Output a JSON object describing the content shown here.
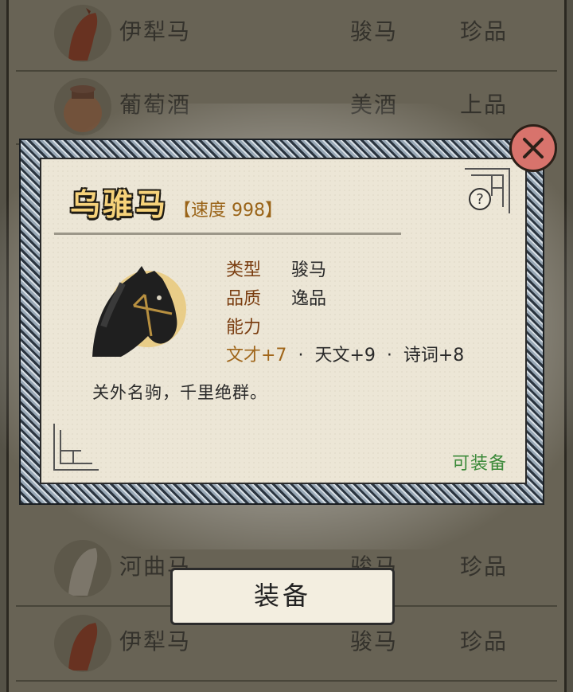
{
  "list": [
    {
      "name": "伊犁马",
      "category": "骏马",
      "quality": "珍品"
    },
    {
      "name": "葡萄酒",
      "category": "美酒",
      "quality": "上品"
    },
    {
      "name": "河曲马",
      "category": "骏马",
      "quality": "珍品"
    },
    {
      "name": "伊犁马",
      "category": "骏马",
      "quality": "珍品"
    }
  ],
  "modal": {
    "title": "乌骓马",
    "stat_tag": "【速度 998】",
    "labels": {
      "type": "类型",
      "quality": "品质",
      "ability": "能力"
    },
    "values": {
      "type": "骏马",
      "quality": "逸品"
    },
    "bonuses": [
      "文才+7",
      "天文+9",
      "诗词+8"
    ],
    "bonus_sep": "·",
    "description": "关外名驹，千里绝群。",
    "status": "可装备",
    "help_glyph": "?",
    "close_icon": "close-icon"
  },
  "equip_button": "装备",
  "colors": {
    "title": "#f6d27a",
    "label": "#7a3d10",
    "stat_tag": "#9a6418",
    "status": "#3c8a3a",
    "close_bg": "#d8736c"
  }
}
